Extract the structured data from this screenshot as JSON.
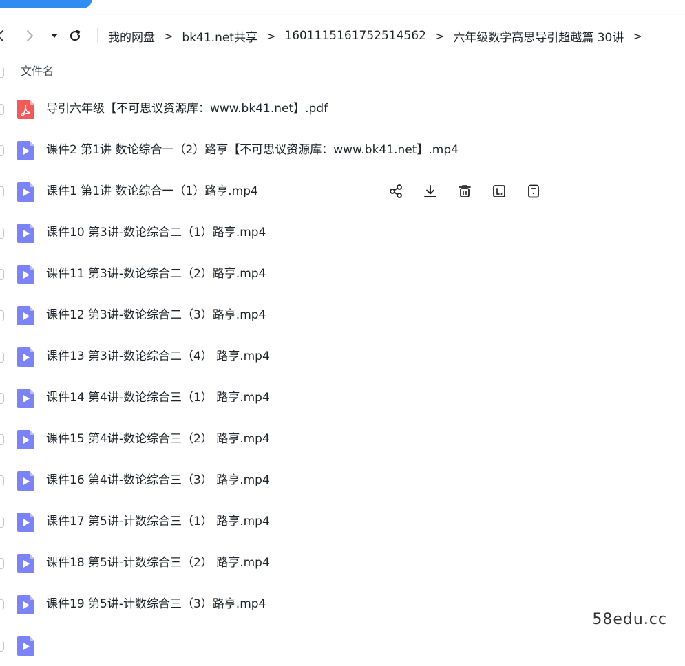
{
  "nav": {
    "back_icon": "chevron-left-icon",
    "forward_icon": "chevron-right-icon",
    "history_icon": "caret-down-icon",
    "refresh_icon": "refresh-icon"
  },
  "breadcrumb": {
    "items": [
      {
        "label": "我的网盘"
      },
      {
        "label": "bk41.net共享"
      },
      {
        "label": "1601115161752514562"
      },
      {
        "label": "六年级数学高思导引超越篇 30讲"
      }
    ],
    "separator": ">"
  },
  "list_header": {
    "name_column": "文件名"
  },
  "files": [
    {
      "name": "导引六年级【不可思议资源库：www.bk41.net】.pdf",
      "type": "pdf"
    },
    {
      "name": "课件2  第1讲 数论综合一（2）路亨【不可思议资源库：www.bk41.net】.mp4",
      "type": "video"
    },
    {
      "name": "课件1  第1讲 数论综合一（1）路亨.mp4",
      "type": "video",
      "hovered": true
    },
    {
      "name": "课件10  第3讲-数论综合二（1）路亨.mp4",
      "type": "video"
    },
    {
      "name": "课件11  第3讲-数论综合二（2）路亨.mp4",
      "type": "video"
    },
    {
      "name": "课件12  第3讲-数论综合二（3）路亨.mp4",
      "type": "video"
    },
    {
      "name": "课件13  第3讲-数论综合二（4） 路亨.mp4",
      "type": "video"
    },
    {
      "name": "课件14  第4讲-数论综合三（1） 路亨.mp4",
      "type": "video"
    },
    {
      "name": "课件15  第4讲-数论综合三（2） 路亨.mp4",
      "type": "video"
    },
    {
      "name": "课件16  第4讲-数论综合三（3） 路亨.mp4",
      "type": "video"
    },
    {
      "name": "课件17  第5讲-计数综合三（1） 路亨.mp4",
      "type": "video"
    },
    {
      "name": "课件18  第5讲-计数综合三（2） 路亨.mp4",
      "type": "video"
    },
    {
      "name": "课件19  第5讲-计数综合三（3）路亨.mp4",
      "type": "video"
    },
    {
      "name": "",
      "type": "video"
    }
  ],
  "row_actions": [
    "share-icon",
    "download-icon",
    "delete-icon",
    "rename-icon",
    "details-icon"
  ],
  "colors": {
    "accent": "#2f8cf0",
    "video_icon": "#7c83f5",
    "pdf_icon": "#f25a5a",
    "text": "#1f2329"
  },
  "watermark": "58edu.cc"
}
